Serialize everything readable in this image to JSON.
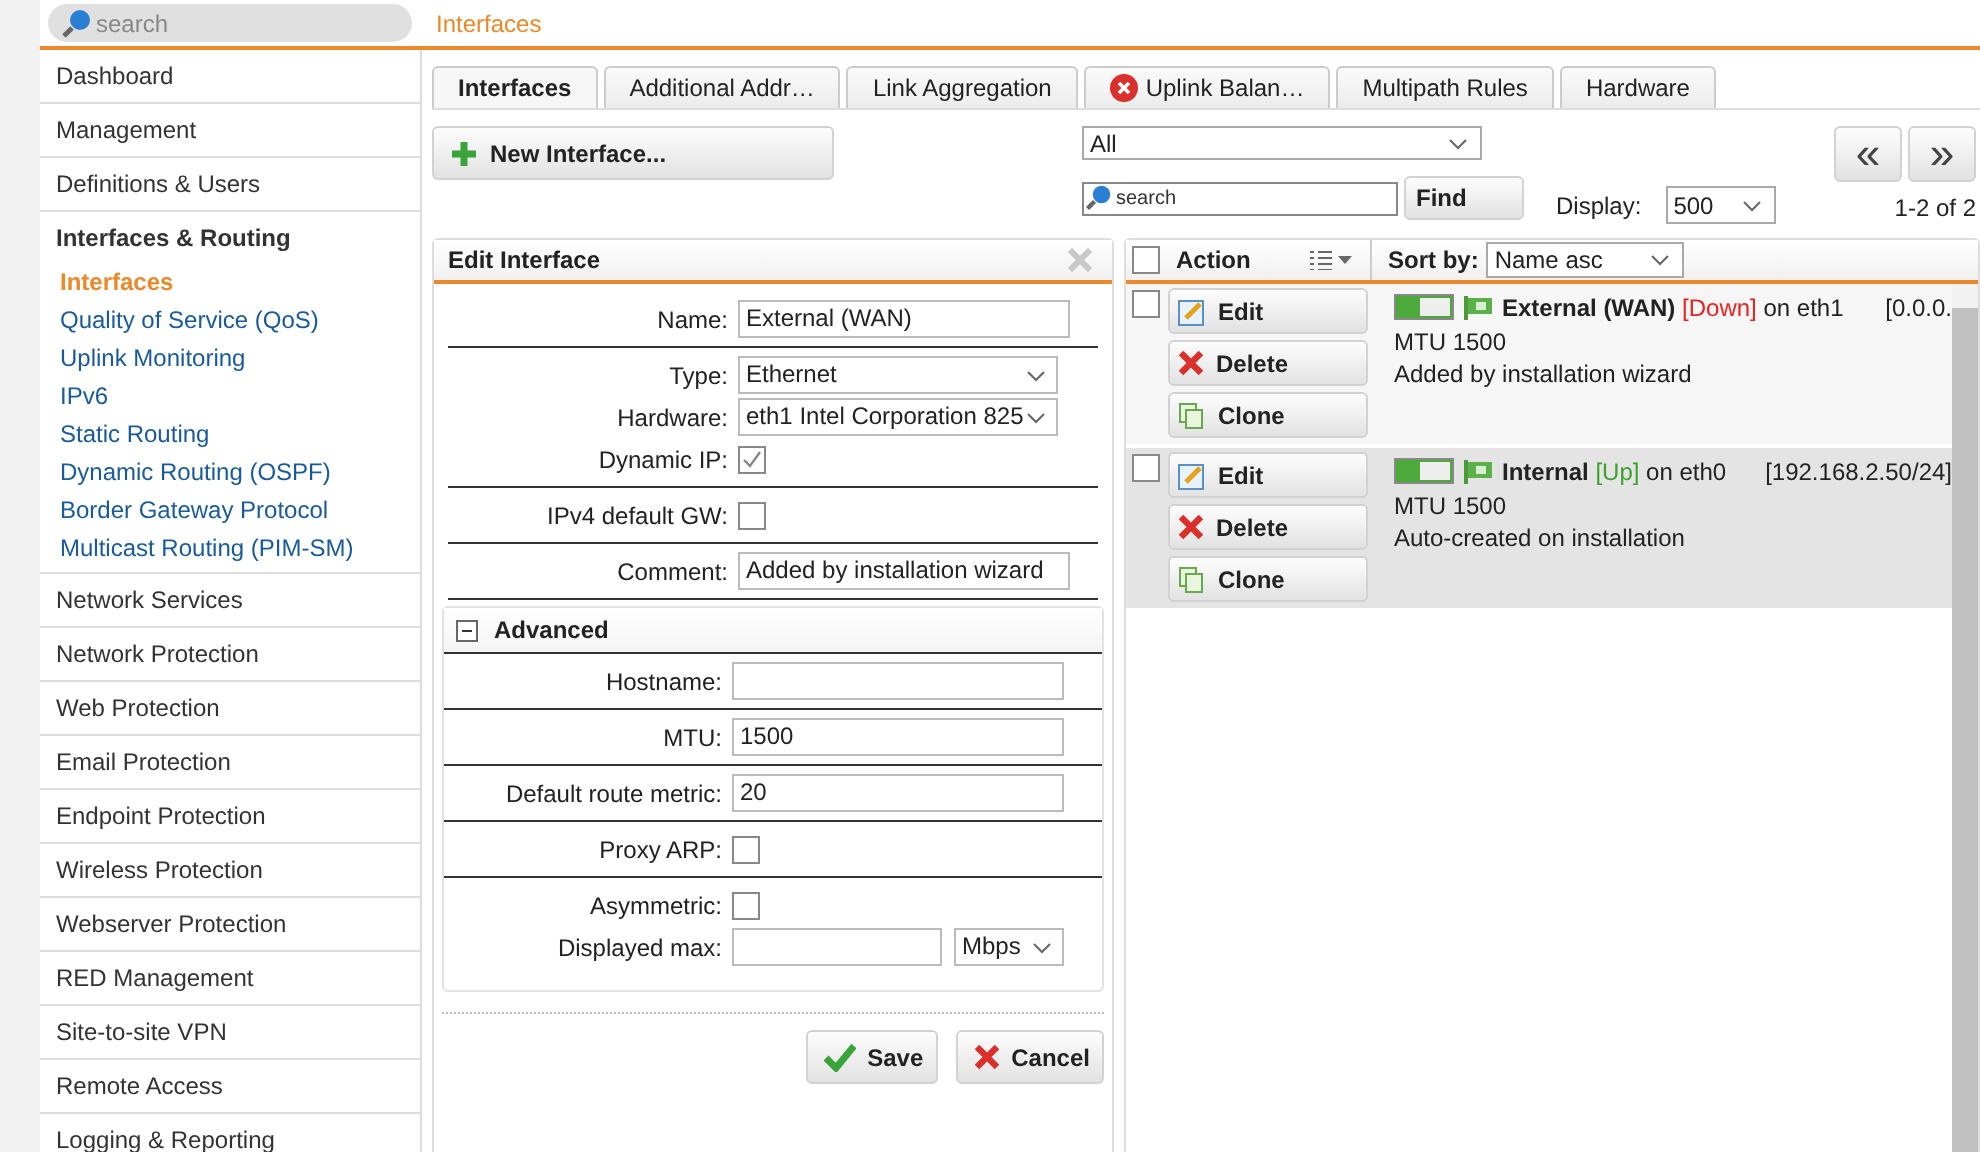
{
  "search": {
    "placeholder": "search"
  },
  "breadcrumb": "Interfaces",
  "sidebar": {
    "items": [
      {
        "label": "Dashboard",
        "expanded": false
      },
      {
        "label": "Management",
        "expanded": false
      },
      {
        "label": "Definitions & Users",
        "expanded": false
      },
      {
        "label": "Interfaces & Routing",
        "expanded": true,
        "children": [
          {
            "label": "Interfaces",
            "selected": true
          },
          {
            "label": "Quality of Service (QoS)",
            "selected": false
          },
          {
            "label": "Uplink Monitoring",
            "selected": false
          },
          {
            "label": "IPv6",
            "selected": false
          },
          {
            "label": "Static Routing",
            "selected": false
          },
          {
            "label": "Dynamic Routing (OSPF)",
            "selected": false
          },
          {
            "label": "Border Gateway Protocol",
            "selected": false
          },
          {
            "label": "Multicast Routing (PIM-SM)",
            "selected": false
          }
        ]
      },
      {
        "label": "Network Services",
        "expanded": false
      },
      {
        "label": "Network Protection",
        "expanded": false
      },
      {
        "label": "Web Protection",
        "expanded": false
      },
      {
        "label": "Email Protection",
        "expanded": false
      },
      {
        "label": "Endpoint Protection",
        "expanded": false
      },
      {
        "label": "Wireless Protection",
        "expanded": false
      },
      {
        "label": "Webserver Protection",
        "expanded": false
      },
      {
        "label": "RED Management",
        "expanded": false
      },
      {
        "label": "Site-to-site VPN",
        "expanded": false
      },
      {
        "label": "Remote Access",
        "expanded": false
      },
      {
        "label": "Logging & Reporting",
        "expanded": false
      }
    ]
  },
  "tabs": [
    {
      "label": "Interfaces",
      "selected": true,
      "error": false
    },
    {
      "label": "Additional Addr…",
      "selected": false,
      "error": false
    },
    {
      "label": "Link Aggregation",
      "selected": false,
      "error": false
    },
    {
      "label": "Uplink Balan…",
      "selected": false,
      "error": true
    },
    {
      "label": "Multipath Rules",
      "selected": false,
      "error": false
    },
    {
      "label": "Hardware",
      "selected": false,
      "error": false
    }
  ],
  "toolbar": {
    "new_button": "New Interface...",
    "filter": "All",
    "search_placeholder": "search",
    "find_button": "Find",
    "display_label": "Display:",
    "display_value": "500",
    "count": "1-2 of 2",
    "prev": "«",
    "next": "»"
  },
  "edit_panel": {
    "title": "Edit Interface",
    "groups": [
      [
        {
          "kind": "text",
          "label": "Name:",
          "value": "External (WAN)"
        }
      ],
      [
        {
          "kind": "select",
          "label": "Type:",
          "value": "Ethernet"
        },
        {
          "kind": "select",
          "label": "Hardware:",
          "value": "eth1 Intel Corporation 825"
        },
        {
          "kind": "checkbox",
          "label": "Dynamic IP:",
          "checked": true
        }
      ],
      [
        {
          "kind": "checkbox",
          "label": "IPv4 default GW:",
          "checked": false
        }
      ],
      [
        {
          "kind": "text",
          "label": "Comment:",
          "value": "Added by installation wizard"
        }
      ]
    ],
    "advanced": {
      "title": "Advanced",
      "expanded": true,
      "groups": [
        [
          {
            "kind": "text",
            "label": "Hostname:"
          }
        ],
        [
          {
            "kind": "text",
            "label": "MTU:",
            "value": "1500"
          }
        ],
        [
          {
            "kind": "text",
            "label": "Default route metric:",
            "value": "20"
          }
        ],
        [
          {
            "kind": "checkbox",
            "label": "Proxy ARP:",
            "checked": false
          }
        ],
        [
          {
            "kind": "checkbox",
            "label": "Asymmetric:",
            "checked": false
          },
          {
            "kind": "unit",
            "label": "Displayed max:",
            "unit": "Mbps"
          }
        ]
      ]
    },
    "save": "Save",
    "cancel": "Cancel"
  },
  "list": {
    "select_all_checked": false,
    "action_header": "Action",
    "sort_label": "Sort by:",
    "sort_value": "Name asc",
    "rows": [
      {
        "checked": false,
        "selected": false,
        "enabled": true,
        "name": "External (WAN)",
        "status": "[Down]",
        "color": "#e8231f",
        "on": "on eth1",
        "address": "[0.0.0.",
        "mtu": "MTU 1500",
        "comment": "Added by installation wizard",
        "actions": [
          "Edit",
          "Delete",
          "Clone"
        ]
      },
      {
        "checked": false,
        "selected": true,
        "enabled": true,
        "name": "Internal",
        "status": "[Up]",
        "color": "#3ca02c",
        "on": "on eth0",
        "address": "[192.168.2.50/24]",
        "mtu": "MTU 1500",
        "comment": "Auto-created on installation",
        "actions": [
          "Edit",
          "Delete",
          "Clone"
        ]
      }
    ]
  }
}
